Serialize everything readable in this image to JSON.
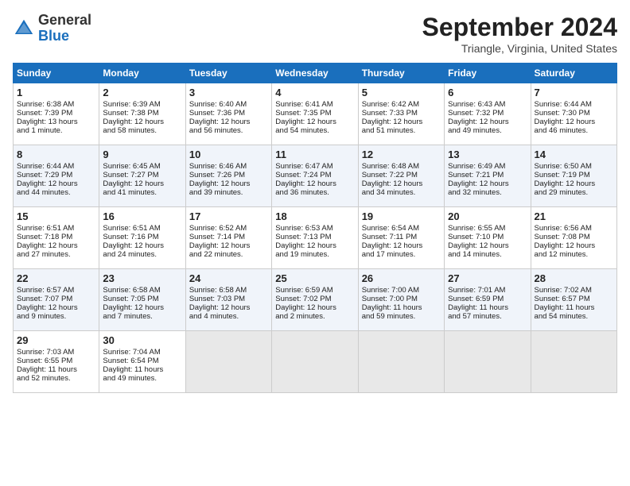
{
  "header": {
    "logo_general": "General",
    "logo_blue": "Blue",
    "title": "September 2024",
    "subtitle": "Triangle, Virginia, United States"
  },
  "days_of_week": [
    "Sunday",
    "Monday",
    "Tuesday",
    "Wednesday",
    "Thursday",
    "Friday",
    "Saturday"
  ],
  "weeks": [
    [
      {
        "day": "1",
        "info": "Sunrise: 6:38 AM\nSunset: 7:39 PM\nDaylight: 13 hours\nand 1 minute."
      },
      {
        "day": "2",
        "info": "Sunrise: 6:39 AM\nSunset: 7:38 PM\nDaylight: 12 hours\nand 58 minutes."
      },
      {
        "day": "3",
        "info": "Sunrise: 6:40 AM\nSunset: 7:36 PM\nDaylight: 12 hours\nand 56 minutes."
      },
      {
        "day": "4",
        "info": "Sunrise: 6:41 AM\nSunset: 7:35 PM\nDaylight: 12 hours\nand 54 minutes."
      },
      {
        "day": "5",
        "info": "Sunrise: 6:42 AM\nSunset: 7:33 PM\nDaylight: 12 hours\nand 51 minutes."
      },
      {
        "day": "6",
        "info": "Sunrise: 6:43 AM\nSunset: 7:32 PM\nDaylight: 12 hours\nand 49 minutes."
      },
      {
        "day": "7",
        "info": "Sunrise: 6:44 AM\nSunset: 7:30 PM\nDaylight: 12 hours\nand 46 minutes."
      }
    ],
    [
      {
        "day": "8",
        "info": "Sunrise: 6:44 AM\nSunset: 7:29 PM\nDaylight: 12 hours\nand 44 minutes."
      },
      {
        "day": "9",
        "info": "Sunrise: 6:45 AM\nSunset: 7:27 PM\nDaylight: 12 hours\nand 41 minutes."
      },
      {
        "day": "10",
        "info": "Sunrise: 6:46 AM\nSunset: 7:26 PM\nDaylight: 12 hours\nand 39 minutes."
      },
      {
        "day": "11",
        "info": "Sunrise: 6:47 AM\nSunset: 7:24 PM\nDaylight: 12 hours\nand 36 minutes."
      },
      {
        "day": "12",
        "info": "Sunrise: 6:48 AM\nSunset: 7:22 PM\nDaylight: 12 hours\nand 34 minutes."
      },
      {
        "day": "13",
        "info": "Sunrise: 6:49 AM\nSunset: 7:21 PM\nDaylight: 12 hours\nand 32 minutes."
      },
      {
        "day": "14",
        "info": "Sunrise: 6:50 AM\nSunset: 7:19 PM\nDaylight: 12 hours\nand 29 minutes."
      }
    ],
    [
      {
        "day": "15",
        "info": "Sunrise: 6:51 AM\nSunset: 7:18 PM\nDaylight: 12 hours\nand 27 minutes."
      },
      {
        "day": "16",
        "info": "Sunrise: 6:51 AM\nSunset: 7:16 PM\nDaylight: 12 hours\nand 24 minutes."
      },
      {
        "day": "17",
        "info": "Sunrise: 6:52 AM\nSunset: 7:14 PM\nDaylight: 12 hours\nand 22 minutes."
      },
      {
        "day": "18",
        "info": "Sunrise: 6:53 AM\nSunset: 7:13 PM\nDaylight: 12 hours\nand 19 minutes."
      },
      {
        "day": "19",
        "info": "Sunrise: 6:54 AM\nSunset: 7:11 PM\nDaylight: 12 hours\nand 17 minutes."
      },
      {
        "day": "20",
        "info": "Sunrise: 6:55 AM\nSunset: 7:10 PM\nDaylight: 12 hours\nand 14 minutes."
      },
      {
        "day": "21",
        "info": "Sunrise: 6:56 AM\nSunset: 7:08 PM\nDaylight: 12 hours\nand 12 minutes."
      }
    ],
    [
      {
        "day": "22",
        "info": "Sunrise: 6:57 AM\nSunset: 7:07 PM\nDaylight: 12 hours\nand 9 minutes."
      },
      {
        "day": "23",
        "info": "Sunrise: 6:58 AM\nSunset: 7:05 PM\nDaylight: 12 hours\nand 7 minutes."
      },
      {
        "day": "24",
        "info": "Sunrise: 6:58 AM\nSunset: 7:03 PM\nDaylight: 12 hours\nand 4 minutes."
      },
      {
        "day": "25",
        "info": "Sunrise: 6:59 AM\nSunset: 7:02 PM\nDaylight: 12 hours\nand 2 minutes."
      },
      {
        "day": "26",
        "info": "Sunrise: 7:00 AM\nSunset: 7:00 PM\nDaylight: 11 hours\nand 59 minutes."
      },
      {
        "day": "27",
        "info": "Sunrise: 7:01 AM\nSunset: 6:59 PM\nDaylight: 11 hours\nand 57 minutes."
      },
      {
        "day": "28",
        "info": "Sunrise: 7:02 AM\nSunset: 6:57 PM\nDaylight: 11 hours\nand 54 minutes."
      }
    ],
    [
      {
        "day": "29",
        "info": "Sunrise: 7:03 AM\nSunset: 6:55 PM\nDaylight: 11 hours\nand 52 minutes."
      },
      {
        "day": "30",
        "info": "Sunrise: 7:04 AM\nSunset: 6:54 PM\nDaylight: 11 hours\nand 49 minutes."
      },
      {
        "day": "",
        "info": ""
      },
      {
        "day": "",
        "info": ""
      },
      {
        "day": "",
        "info": ""
      },
      {
        "day": "",
        "info": ""
      },
      {
        "day": "",
        "info": ""
      }
    ]
  ]
}
